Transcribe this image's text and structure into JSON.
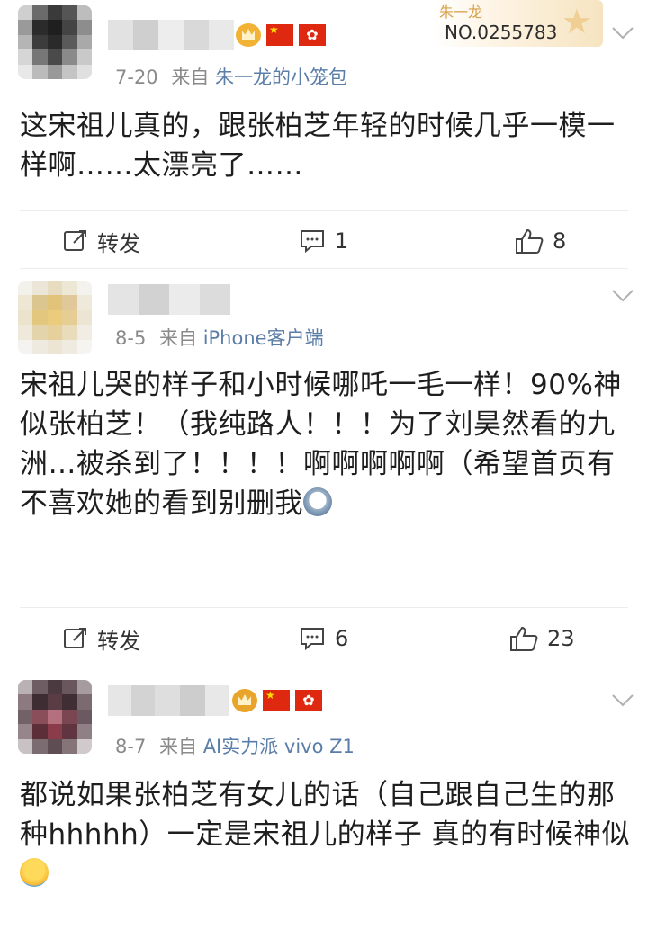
{
  "posts": [
    {
      "date": "7-20",
      "from_prefix": "来自",
      "source": "朱一龙的小笼包",
      "text": "这宋祖儿真的，跟张柏芝年轻的时候几乎一模一样啊……太漂亮了……",
      "repost_label": "转发",
      "comments": "1",
      "likes": "8",
      "badge_card": {
        "name": "朱一龙",
        "number": "NO.0255783"
      }
    },
    {
      "date": "8-5",
      "from_prefix": "来自",
      "source": "iPhone客户端",
      "text": "宋祖儿哭的样子和小时候哪吒一毛一样！90%神似张柏芝！（我纯路人！！！为了刘昊然看的九洲…被杀到了！！！！啊啊啊啊啊（希望首页有不喜欢她的看到别删我",
      "repost_label": "转发",
      "comments": "6",
      "likes": "23"
    },
    {
      "date": "8-7",
      "from_prefix": "来自",
      "source": "AI实力派 vivo Z1",
      "text": "都说如果张柏芝有女儿的话（自己跟自己生的那种hhhhh）一定是宋祖儿的样子 真的有时候神似"
    }
  ],
  "icons": [
    "repost-icon",
    "comment-icon",
    "like-icon",
    "chevron-down-icon",
    "crown-icon",
    "china-flag-icon",
    "hongkong-flag-icon"
  ],
  "colors": {
    "source_link": "#5b7ea8",
    "meta_gray": "#8a8a8a",
    "badge_gold": "#d8a04a"
  }
}
